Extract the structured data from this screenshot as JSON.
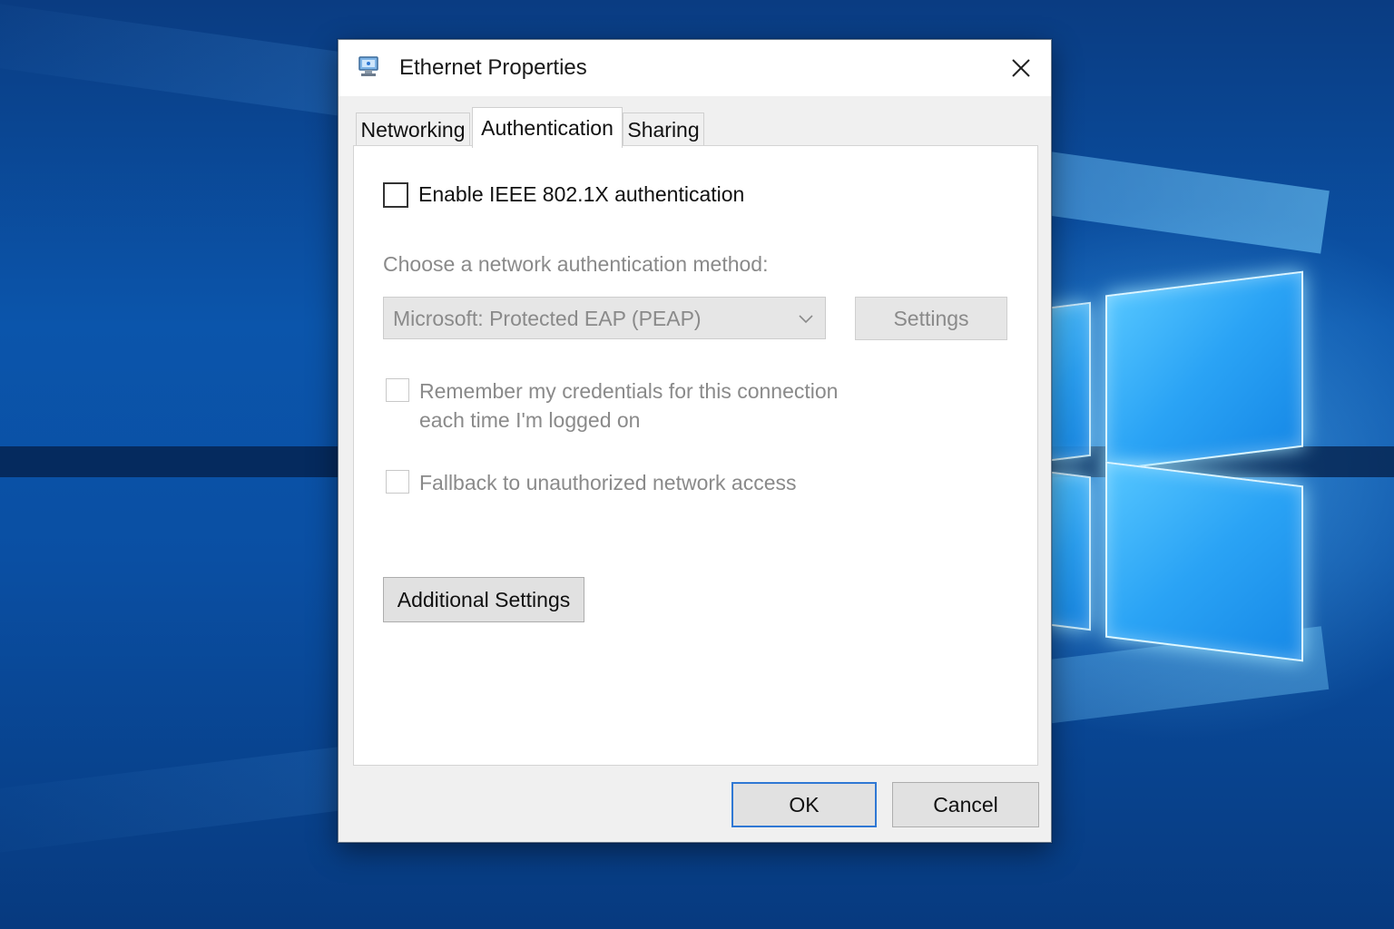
{
  "window": {
    "title": "Ethernet Properties",
    "icon": "network-adapter-icon"
  },
  "tabs": [
    {
      "label": "Networking",
      "selected": false
    },
    {
      "label": "Authentication",
      "selected": true
    },
    {
      "label": "Sharing",
      "selected": false
    }
  ],
  "auth": {
    "enable_label": "Enable IEEE 802.1X authentication",
    "enable_checked": false,
    "method_prompt": "Choose a network authentication method:",
    "method_value": "Microsoft: Protected EAP (PEAP)",
    "settings_label": "Settings",
    "remember_line1": "Remember my credentials for this connection",
    "remember_line2": "each time I'm logged on",
    "remember_checked": false,
    "fallback_label": "Fallback to unauthorized network access",
    "fallback_checked": false,
    "additional_settings_label": "Additional Settings"
  },
  "footer": {
    "ok_label": "OK",
    "cancel_label": "Cancel"
  },
  "colors": {
    "accent": "#2f78d4",
    "disabled_text": "#8a8a8a",
    "desktop_blue": "#0b55ab"
  }
}
